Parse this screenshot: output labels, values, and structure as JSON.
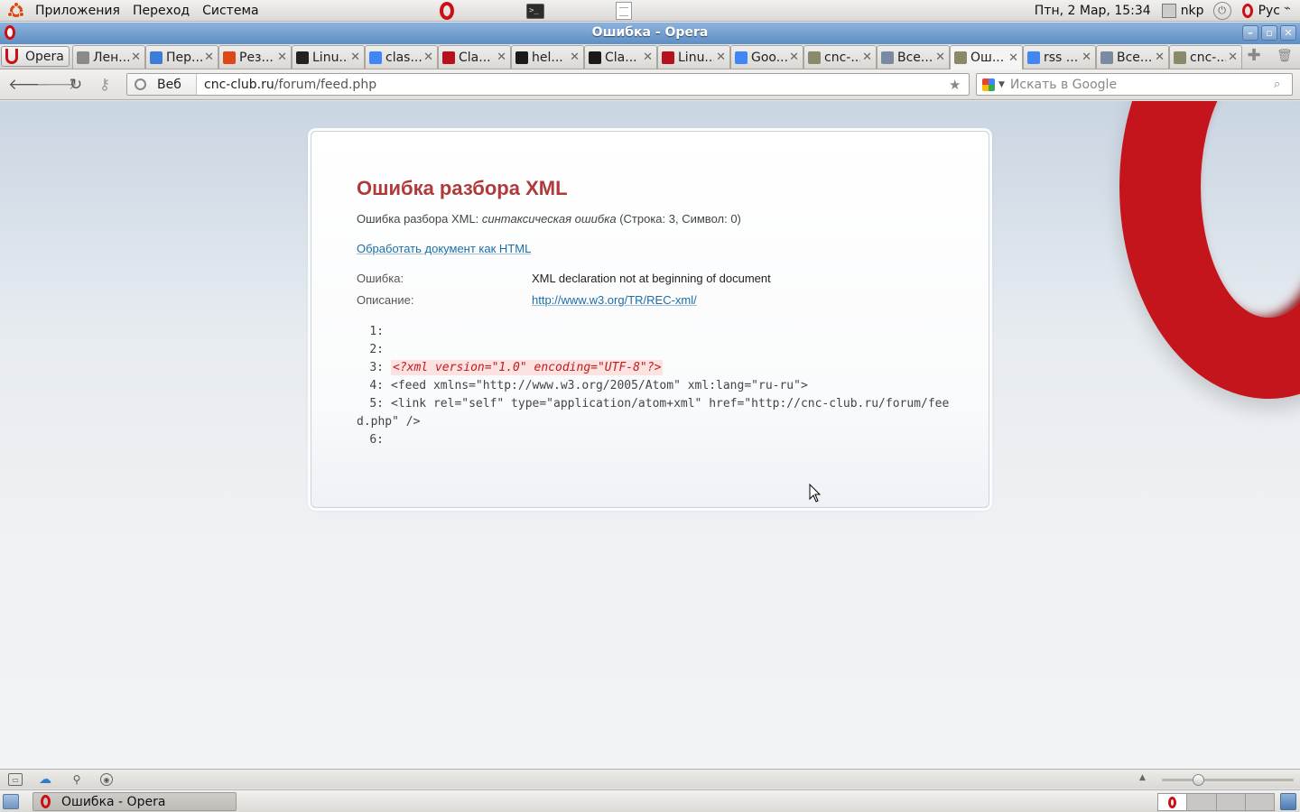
{
  "top_panel": {
    "menus": [
      "Приложения",
      "Переход",
      "Система"
    ],
    "clock": "Птн,  2 Мар, 15:34",
    "user": "nkp",
    "lang": "Рус"
  },
  "window": {
    "title": "Ошибка - Opera"
  },
  "browser": {
    "menu_label": "Opera",
    "tabs": [
      {
        "label": "Лен...",
        "fav_color": "#8a8a8a"
      },
      {
        "label": "Пер...",
        "fav_color": "#3b7dd8"
      },
      {
        "label": "Рез...",
        "fav_color": "#dd4814"
      },
      {
        "label": "Linu...",
        "fav_color": "#222222"
      },
      {
        "label": "clas...",
        "fav_color": "#4285f4"
      },
      {
        "label": "Cla...",
        "fav_color": "#b5121b"
      },
      {
        "label": "hel...",
        "fav_color": "#1a1a1a"
      },
      {
        "label": "Cla...",
        "fav_color": "#1a1a1a"
      },
      {
        "label": "Linu...",
        "fav_color": "#b5121b"
      },
      {
        "label": "Goo...",
        "fav_color": "#4285f4"
      },
      {
        "label": "cnc-...",
        "fav_color": "#8a8a6a"
      },
      {
        "label": "Все...",
        "fav_color": "#7a8aa0"
      },
      {
        "label": "Ош...",
        "fav_color": "#8a8a6a",
        "active": true
      },
      {
        "label": "rss ...",
        "fav_color": "#4285f4"
      },
      {
        "label": "Все...",
        "fav_color": "#7a8aa0"
      },
      {
        "label": "cnc-...",
        "fav_color": "#8a8a6a"
      }
    ],
    "address": {
      "site_label": "Веб",
      "host": "cnc-club.ru",
      "path": "/forum/feed.php"
    },
    "search_placeholder": "Искать в Google"
  },
  "page": {
    "heading": "Ошибка разбора XML",
    "summary_prefix": "Ошибка разбора XML: ",
    "summary_error": "синтаксическая ошибка",
    "summary_suffix": " (Строка: 3, Символ: 0)",
    "html_link": "Обработать документ как HTML",
    "error_label": "Ошибка:",
    "error_value": "XML declaration not at beginning of document",
    "desc_label": "Описание:",
    "desc_link": "http://www.w3.org/TR/REC-xml/",
    "code_lines": [
      {
        "num": "1:",
        "text": ""
      },
      {
        "num": "2:",
        "text": ""
      },
      {
        "num": "3:",
        "text": "<?xml version=\"1.0\" encoding=\"UTF-8\"?>",
        "error": true
      },
      {
        "num": "4:",
        "text": "<feed xmlns=\"http://www.w3.org/2005/Atom\" xml:lang=\"ru-ru\">"
      },
      {
        "num": "5:",
        "text": "<link rel=\"self\" type=\"application/atom+xml\" href=\"http://cnc-club.ru/forum/feed.php\" />"
      },
      {
        "num": "6:",
        "text": ""
      }
    ]
  },
  "taskbar": {
    "task_label": "Ошибка - Opera"
  },
  "colors": {
    "opera_red": "#cc0f16",
    "heading_red": "#b03a3a",
    "link_blue": "#1b6ea8",
    "titlebar_blue": "#6b98cc"
  }
}
